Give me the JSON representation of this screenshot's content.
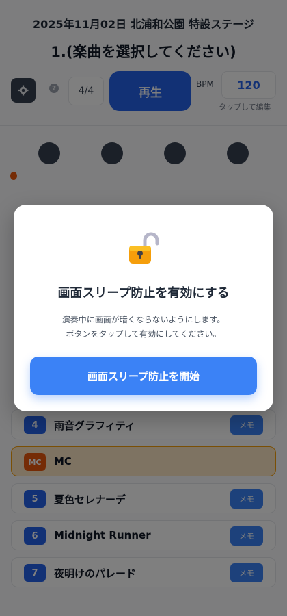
{
  "header": {
    "event_title": "2025年11月02日 北浦和公園 特設ステージ",
    "song_title": "1.(楽曲を選択してください)"
  },
  "controls": {
    "time_signature": "4/4",
    "play_label": "再生",
    "bpm_label": "BPM",
    "bpm_value": "120",
    "bpm_hint": "タップして編集"
  },
  "beats": {
    "count": 4
  },
  "setlist": [
    {
      "number": "4",
      "title": "雨音グラフィティ",
      "memo": "メモ",
      "type": "song"
    },
    {
      "number": "MC",
      "title": "MC",
      "memo": "",
      "type": "mc"
    },
    {
      "number": "5",
      "title": "夏色セレナーデ",
      "memo": "メモ",
      "type": "song"
    },
    {
      "number": "6",
      "title": "Midnight Runner",
      "memo": "メモ",
      "type": "song"
    },
    {
      "number": "7",
      "title": "夜明けのパレード",
      "memo": "メモ",
      "type": "song"
    }
  ],
  "modal": {
    "icon": "unlocked-padlock-icon",
    "heading": "画面スリープ防止を有効にする",
    "desc_line1": "演奏中に画面が暗くならないようにします。",
    "desc_line2": "ボタンをタップして有効にしてください。",
    "start_button": "画面スリープ防止を開始"
  },
  "colors": {
    "accent": "#3b82f6",
    "play": "#2563eb",
    "mc_highlight": "#f59e0b",
    "overlay": "rgba(0,0,0,0.5)"
  }
}
